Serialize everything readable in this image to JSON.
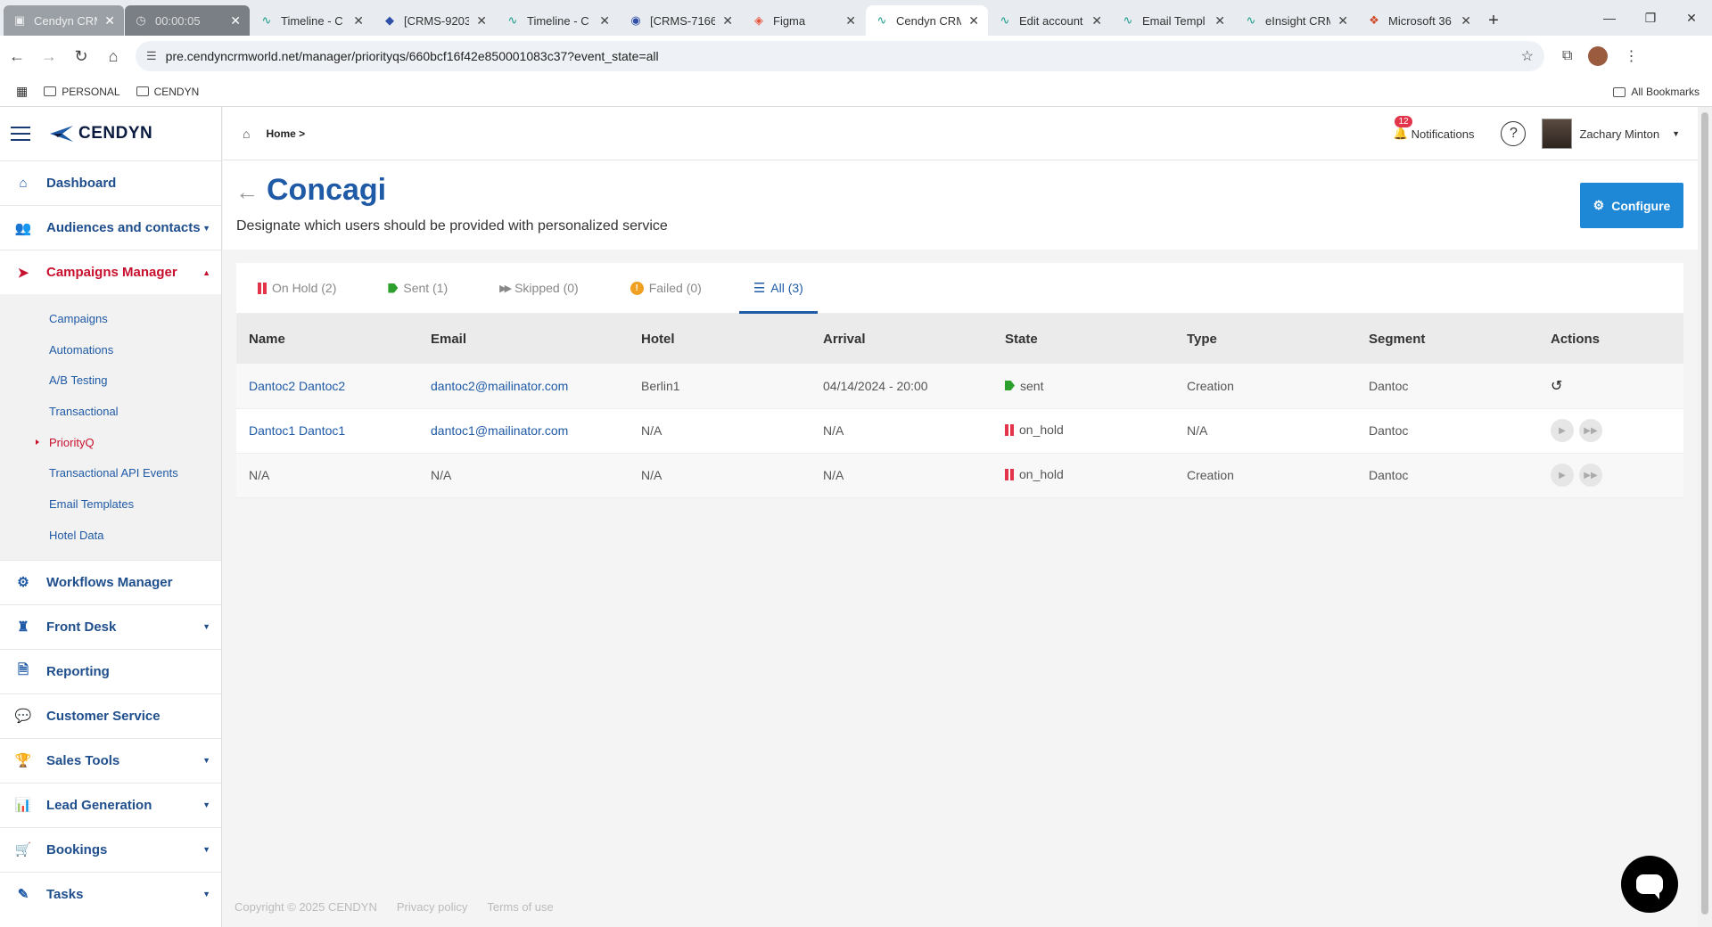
{
  "browser": {
    "tabs": [
      {
        "label": "Cendyn CRM",
        "icon": "recording-icon"
      },
      {
        "label": "00:00:05",
        "icon": "timer-icon"
      },
      {
        "label": "Timeline - C",
        "icon": "cendyn-icon"
      },
      {
        "label": "[CRMS-9203",
        "icon": "jira-icon"
      },
      {
        "label": "Timeline - C",
        "icon": "cendyn-icon"
      },
      {
        "label": "[CRMS-7166",
        "icon": "jira-icon"
      },
      {
        "label": "Figma",
        "icon": "figma-icon"
      },
      {
        "label": "Cendyn CRM",
        "icon": "cendyn-icon",
        "active": true
      },
      {
        "label": "Edit account",
        "icon": "cendyn-icon"
      },
      {
        "label": "Email Templ",
        "icon": "cendyn-icon"
      },
      {
        "label": "eInsight CRM",
        "icon": "cendyn-icon"
      },
      {
        "label": "Microsoft 36",
        "icon": "microsoft-icon"
      }
    ],
    "url": "pre.cendyncrmworld.net/manager/priorityqs/660bcf16f42e850001083c37?event_state=all",
    "bookmarks": [
      "PERSONAL",
      "CENDYN"
    ],
    "all_bookmarks": "All Bookmarks"
  },
  "sidebar": {
    "brand": "CENDYN",
    "items": [
      {
        "label": "Dashboard",
        "icon": "home-icon"
      },
      {
        "label": "Audiences and contacts",
        "icon": "users-icon",
        "caret": "▼"
      },
      {
        "label": "Campaigns Manager",
        "icon": "paper-plane-icon",
        "caret": "▲"
      }
    ],
    "subitems": [
      "Campaigns",
      "Automations",
      "A/B Testing",
      "Transactional",
      "PriorityQ",
      "Transactional API Events",
      "Email Templates",
      "Hotel Data"
    ],
    "active_subitem": "PriorityQ",
    "items_bottom": [
      {
        "label": "Workflows Manager",
        "icon": "gears-icon"
      },
      {
        "label": "Front Desk",
        "icon": "bellhop-icon",
        "caret": "▼"
      },
      {
        "label": "Reporting",
        "icon": "document-icon"
      },
      {
        "label": "Customer Service",
        "icon": "chat-icon"
      },
      {
        "label": "Sales Tools",
        "icon": "trophy-icon",
        "caret": "▼"
      },
      {
        "label": "Lead Generation",
        "icon": "bar-chart-icon",
        "caret": "▼"
      },
      {
        "label": "Bookings",
        "icon": "cart-icon",
        "caret": "▼"
      },
      {
        "label": "Tasks",
        "icon": "pencil-icon",
        "caret": "▼"
      }
    ]
  },
  "topbar": {
    "breadcrumb": "Home >",
    "notifications_count": "12",
    "notifications_label": "Notifications",
    "help": "?",
    "user_name": "Zachary Minton"
  },
  "page": {
    "title": "Concagi",
    "description": "Designate which users should be provided with personalized service",
    "configure_label": "Configure"
  },
  "tabs": [
    {
      "label": "On Hold (2)",
      "icon": "pause-icon"
    },
    {
      "label": "Sent (1)",
      "icon": "sent-flag-icon"
    },
    {
      "label": "Skipped (0)",
      "icon": "fast-forward-icon"
    },
    {
      "label": "Failed (0)",
      "icon": "warning-icon"
    },
    {
      "label": "All (3)",
      "icon": "list-icon",
      "active": true
    }
  ],
  "table": {
    "columns": [
      "Name",
      "Email",
      "Hotel",
      "Arrival",
      "State",
      "Type",
      "Segment",
      "Actions"
    ],
    "rows": [
      {
        "name": "Dantoc2 Dantoc2",
        "email": "dantoc2@mailinator.com",
        "hotel": "Berlin1",
        "arrival": "04/14/2024 - 20:00",
        "state": "sent",
        "type": "Creation",
        "segment": "Dantoc"
      },
      {
        "name": "Dantoc1 Dantoc1",
        "email": "dantoc1@mailinator.com",
        "hotel": "N/A",
        "arrival": "N/A",
        "state": "on_hold",
        "type": "N/A",
        "segment": "Dantoc"
      },
      {
        "name": "N/A",
        "email": "N/A",
        "hotel": "N/A",
        "arrival": "N/A",
        "state": "on_hold",
        "type": "Creation",
        "segment": "Dantoc"
      }
    ]
  },
  "footer": {
    "copyright": "Copyright © 2025 CENDYN",
    "privacy": "Privacy policy",
    "terms": "Terms of use"
  },
  "colors": {
    "brand_blue": "#1f5aa6",
    "accent_red": "#c8102e",
    "configure_blue": "#1e88d6",
    "sent_green": "#2ca02c",
    "hold_red": "#e2344a"
  }
}
